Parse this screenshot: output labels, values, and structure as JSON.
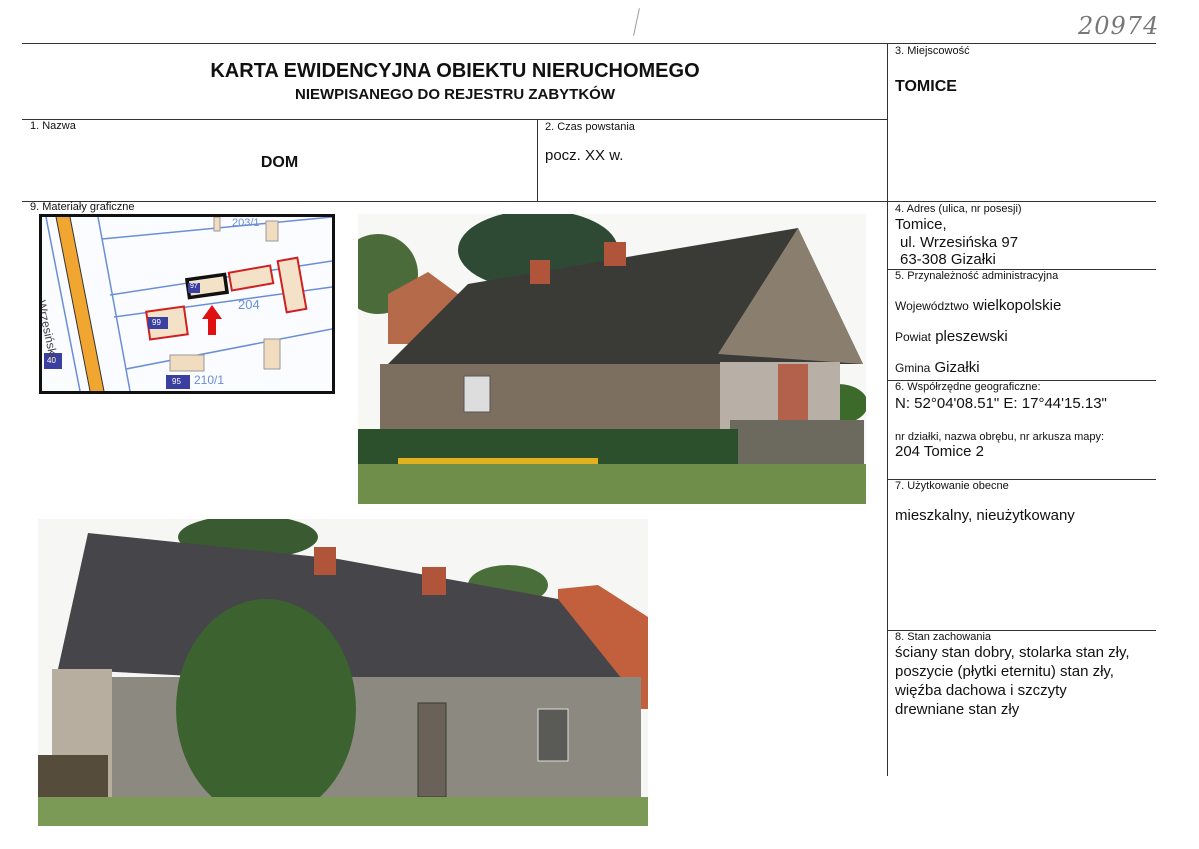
{
  "handwritten_number": "20974",
  "title": {
    "line1": "KARTA EWIDENCYJNA OBIEKTU NIERUCHOMEGO",
    "line2": "NIEWPISANEGO DO REJESTRU ZABYTKÓW"
  },
  "fields": {
    "nazwa": {
      "label": "1. Nazwa",
      "value": "DOM"
    },
    "czas": {
      "label": "2. Czas powstania",
      "value": "pocz. XX w."
    },
    "miejscowosc": {
      "label": "3. Miejscowość",
      "value": "TOMICE"
    },
    "adres": {
      "label": "4. Adres (ulica, nr posesji)",
      "line1": "Tomice,",
      "line2": "ul. Wrzesińska 97",
      "line3": "63-308 Gizałki"
    },
    "przynaleznosc": {
      "label": "5. Przynależność administracyjna",
      "wojewodztwo_prefix": "Województwo",
      "wojewodztwo": "wielkopolskie",
      "powiat_prefix": "Powiat",
      "powiat": "pleszewski",
      "gmina_prefix": "Gmina",
      "gmina": "Gizałki"
    },
    "wspolrzedne": {
      "label": "6. Współrzędne geograficzne:",
      "value": "N: 52°04'08.51\" E: 17°44'15.13\"",
      "dzialka_label": "nr działki, nazwa obrębu, nr arkusza mapy:",
      "dzialka_value": "204 Tomice 2"
    },
    "uzytkowanie": {
      "label": "7. Użytkowanie obecne",
      "value": "mieszkalny, nieużytkowany"
    },
    "stan": {
      "label": "8. Stan zachowania",
      "lines": [
        "ściany stan dobry, stolarka stan zły,",
        "poszycie (płytki eternitu) stan zły,",
        "więźba dachowa i szczyty",
        "drewniane stan zły"
      ]
    },
    "materialy": {
      "label": "9. Materiały graficzne"
    }
  },
  "map": {
    "street": "Wrzesińska",
    "parcel_main": "204",
    "parcel_bottom": "210/1",
    "parcel_top": "203/1",
    "building_marked": "97",
    "building_99": "99",
    "building_40": "40",
    "building_95": "95"
  }
}
